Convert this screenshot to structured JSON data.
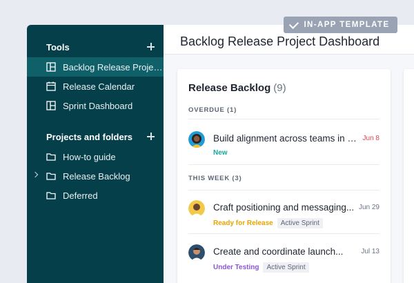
{
  "badge": {
    "label": "IN-APP TEMPLATE"
  },
  "header": {
    "title": "Backlog Release Project Dashboard"
  },
  "sidebar": {
    "tools": {
      "heading": "Tools",
      "items": [
        {
          "label": "Backlog Release Projec...",
          "icon": "dashboard-icon",
          "active": true
        },
        {
          "label": "Release Calendar",
          "icon": "calendar-icon",
          "active": false
        },
        {
          "label": "Sprint Dashboard",
          "icon": "dashboard-icon",
          "active": false
        }
      ]
    },
    "projects": {
      "heading": "Projects and folders",
      "items": [
        {
          "label": "How-to guide",
          "icon": "folder-icon"
        },
        {
          "label": "Release Backlog",
          "icon": "folder-icon",
          "expandable": true
        },
        {
          "label": "Deferred",
          "icon": "folder-icon"
        }
      ]
    }
  },
  "panel": {
    "title": "Release Backlog",
    "count": "(9)",
    "sections": [
      {
        "heading": "OVERDUE (1)",
        "tasks": [
          {
            "title": "Build alignment across teams in t...",
            "date": "Jun 8",
            "status": "New",
            "status_color": "#1aa79c",
            "chip": ""
          }
        ]
      },
      {
        "heading": "THIS WEEK (3)",
        "tasks": [
          {
            "title": "Craft positioning and messaging...",
            "date": "Jun 29",
            "status": "Ready for Release",
            "status_color": "#e7a400",
            "chip": "Active Sprint"
          },
          {
            "title": "Create and coordinate launch...",
            "date": "Jul 13",
            "status": "Under Testing",
            "status_color": "#8a55d6",
            "chip": "Active Sprint"
          }
        ]
      }
    ]
  },
  "colors": {
    "sidebar_bg": "#053f4a",
    "sidebar_active": "#10606a",
    "overdue": "#e04050"
  }
}
